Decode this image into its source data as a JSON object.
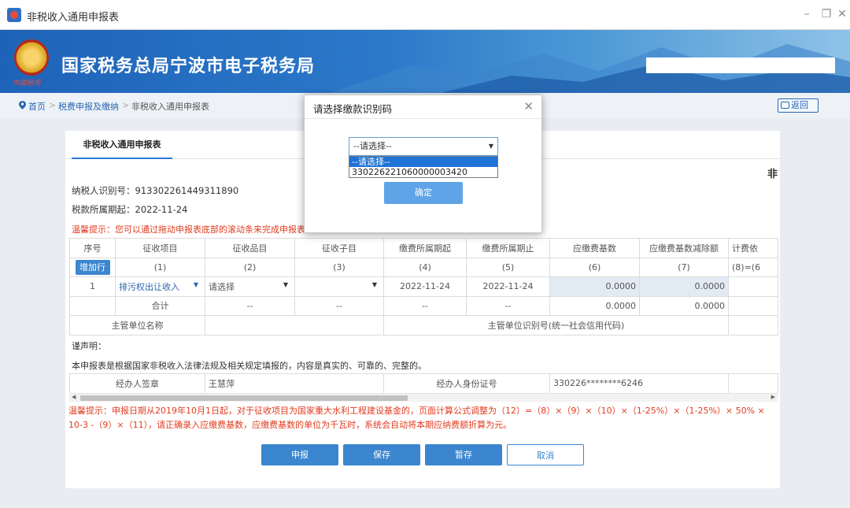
{
  "window": {
    "title": "非税收入通用申报表"
  },
  "banner": {
    "title": "国家税务总局宁波市电子税务局",
    "emblem_caption": "中国税务"
  },
  "breadcrumb": {
    "home": "首页",
    "level1": "税费申报及缴纳",
    "current": "非税收入通用申报表",
    "sep": ">"
  },
  "back_button": "返回",
  "tab": "非税收入通用申报表",
  "corner_char": "非",
  "info": {
    "taxpayer_id": "纳税人识别号：913302261449311890",
    "period_start": "税款所属期起：2022-11-24",
    "tip": "温馨提示：您可以通过拖动申报表底部的滚动条来完成申报表在"
  },
  "table": {
    "headers": [
      "序号",
      "征收项目",
      "征收品目",
      "征收子目",
      "缴费所属期起",
      "缴费所属期止",
      "应缴费基数",
      "应缴费基数减除额",
      "计费依"
    ],
    "header_codes": [
      "",
      "(1)",
      "(2)",
      "(3)",
      "(4)",
      "(5)",
      "(6)",
      "(7)",
      "(8)=(6"
    ],
    "add_row": "增加行",
    "row1": {
      "seq": "1",
      "item": "排污权出让收入",
      "subitem": "请选择",
      "subsub": "",
      "start": "2022-11-24",
      "end": "2022-11-24",
      "base": "0.0000",
      "deduct": "0.0000"
    },
    "total": {
      "label": "合计",
      "c2": "--",
      "c3": "--",
      "c4": "--",
      "c5": "--",
      "base": "0.0000",
      "deduct": "0.0000"
    },
    "org_name_label": "主管单位名称",
    "org_id_label": "主管单位识别号(统一社会信用代码)"
  },
  "declaration": {
    "title": "谨声明：",
    "text": "本申报表是根据国家非税收入法律法规及相关规定填报的，内容是真实的、可靠的、完整的。",
    "signer_label": "经办人签章",
    "signer_value": "王慧萍",
    "id_label": "经办人身份证号",
    "id_value": "330226********6246"
  },
  "bottom_tip": "温馨提示：申报日期从2019年10月1日起，对于征收项目为国家重大水利工程建设基金的，页面计算公式调整为（12）=（8）×（9）×（10）×（1-25%）×（1-25%）× 50% × 10-3 -（9）×（11），请正确录入应缴费基数，应缴费基数的单位为千瓦时，系统会自动将本期应纳费额折算为元。",
  "buttons": {
    "submit": "申报",
    "save": "保存",
    "temp_save": "暂存",
    "cancel": "取消"
  },
  "modal": {
    "title": "请选择缴款识别码",
    "selected": "--请选择--",
    "options": [
      "--请选择--",
      "330226221060000003420"
    ],
    "confirm": "确定"
  },
  "colors": {
    "accent": "#3b86cf",
    "warning": "#e03c1f",
    "banner": "#1e63b8"
  }
}
